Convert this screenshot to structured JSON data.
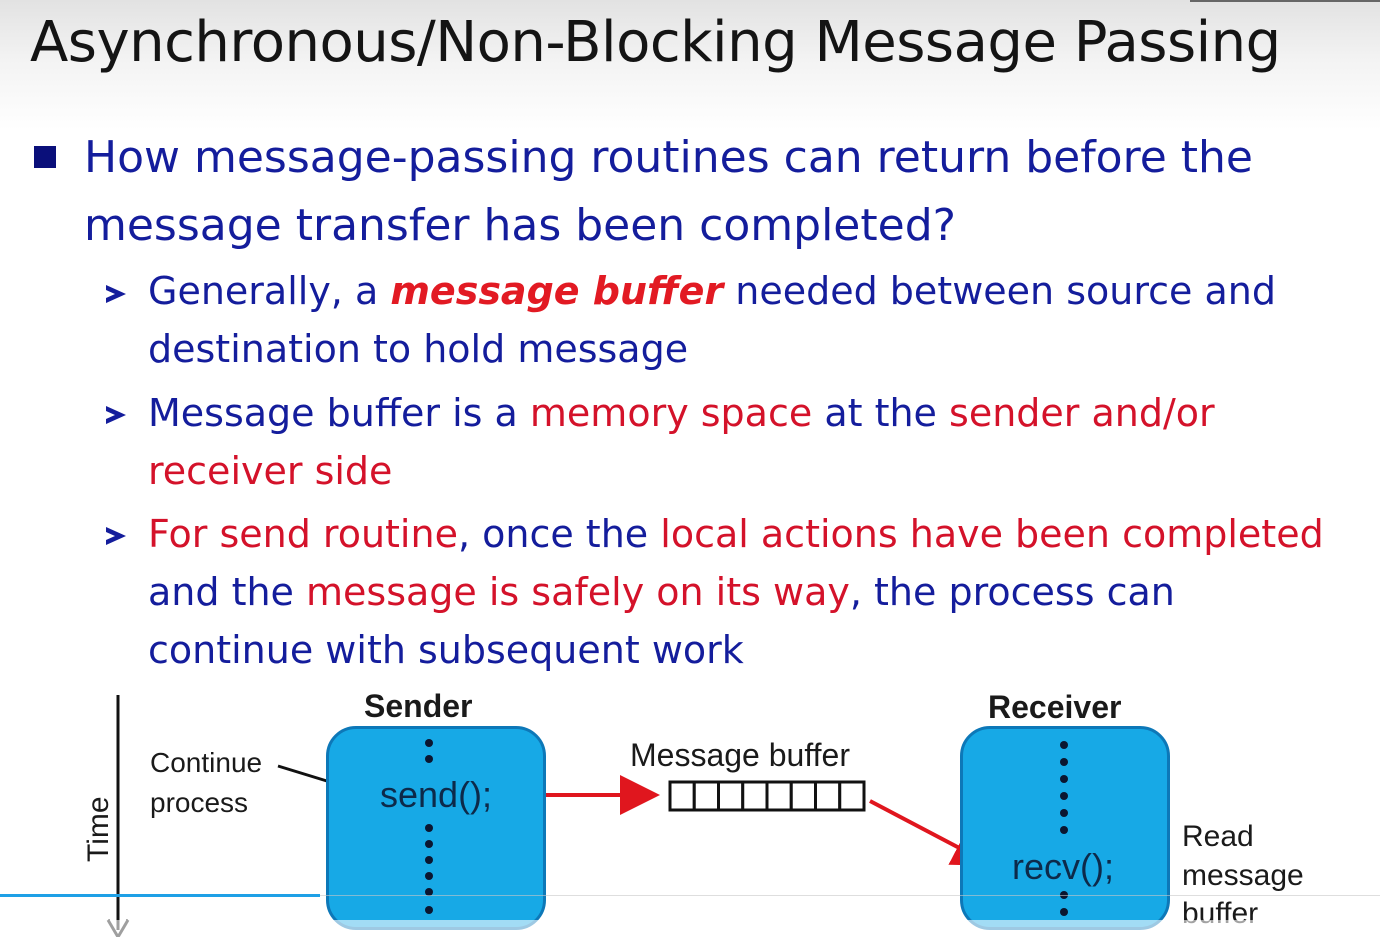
{
  "slide": {
    "title": "Asynchronous/Non-Blocking Message Passing",
    "main_bullet": "How message-passing routines can return before the message transfer has been completed?",
    "sub1": {
      "a": "Generally, a ",
      "b": "message buffer",
      "c": "  needed between source and destination to hold message"
    },
    "sub2": {
      "a": "Message buffer is a ",
      "b": "memory space",
      "c": " at the ",
      "d": "sender and/or receiver side"
    },
    "sub3": {
      "a": "For send routine",
      "b": ", once the ",
      "c": "local actions have been completed",
      "d": " and the ",
      "e": "message is safely on its way",
      "f": ", the process can continue with subsequent work"
    }
  },
  "diagram": {
    "time_label": "Time",
    "sender_title": "Sender",
    "receiver_title": "Receiver",
    "continue_label_1": "Continue",
    "continue_label_2": "process",
    "send_call": "send();",
    "recv_call": "recv();",
    "buffer_label": "Message buffer",
    "read_label_1": "Read",
    "read_label_2": "message",
    "read_label_3": "buffer",
    "buffer_cells": 8
  },
  "colors": {
    "title_text": "#141414",
    "bullet_blue": "#141d9c",
    "emphasis_red": "#d4122a",
    "box_fill": "#17a9e6",
    "arrow_red": "#e0161e"
  }
}
